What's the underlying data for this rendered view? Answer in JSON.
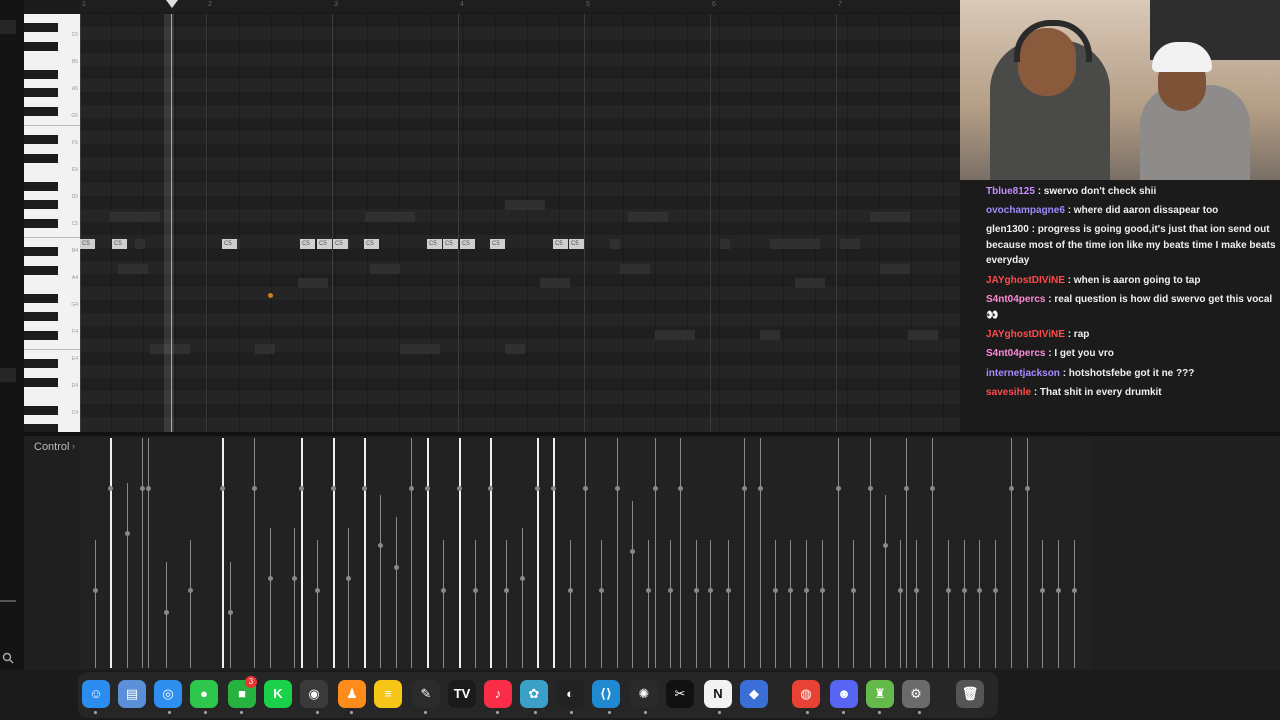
{
  "timeline": {
    "bars": [
      "1",
      "2",
      "3",
      "4",
      "5",
      "6",
      "7"
    ]
  },
  "piano": {
    "labels": [
      "C6",
      "B5",
      "A5",
      "G5",
      "F5",
      "E5",
      "D5",
      "C5",
      "B4",
      "A4",
      "G4",
      "F4",
      "E4",
      "D4",
      "C4"
    ]
  },
  "notes": {
    "label": "C5"
  },
  "control": {
    "label": "Control",
    "chevron": "›"
  },
  "chat": {
    "messages": [
      {
        "user": "Tblue8125",
        "color": "#c58cff",
        "text": " : swervo don't check shii"
      },
      {
        "user": "ovochampagne6",
        "color": "#9c8cff",
        "text": " : where did aaron dissapear too"
      },
      {
        "user": "glen1300",
        "color": "#f0f0f0",
        "text": " : progress is going good,it's just that ion send out because most of the time ion like my beats time I make beats everyday"
      },
      {
        "user": "JAYghostDIViNE",
        "color": "#ff4b4b",
        "text": " : when is aaron going to tap"
      },
      {
        "user": "S4nt04percs",
        "color": "#ff8ad8",
        "text": " : real question is how did swervo get this vocal 👀"
      },
      {
        "user": "JAYghostDIViNE",
        "color": "#ff4b4b",
        "text": " : rap"
      },
      {
        "user": "S4nt04percs",
        "color": "#ff8ad8",
        "text": " : I get you vro"
      },
      {
        "user": "internetjackson",
        "color": "#a78bff",
        "text": " : hotshotsfebe got it ne ???"
      },
      {
        "user": "savesihle",
        "color": "#ff4b4b",
        "text": " : That shit in every drumkit"
      }
    ]
  },
  "dock": {
    "badge": "3",
    "apps": [
      {
        "name": "finder-icon",
        "glyph": "☺",
        "bg": "#2d8cf0"
      },
      {
        "name": "files-icon",
        "glyph": "▤",
        "bg": "#5b8fd8"
      },
      {
        "name": "safari-icon",
        "glyph": "◎",
        "bg": "#2f8ff0"
      },
      {
        "name": "messages-icon",
        "glyph": "●",
        "bg": "#2ec64b"
      },
      {
        "name": "facetime-icon",
        "glyph": "■",
        "bg": "#27b33f"
      },
      {
        "name": "kick-icon",
        "glyph": "K",
        "bg": "#1ad14a"
      },
      {
        "name": "obs-icon",
        "glyph": "◉",
        "bg": "#3a3a3a"
      },
      {
        "name": "fl-studio-icon",
        "glyph": "♟",
        "bg": "#ff8c1a"
      },
      {
        "name": "notes-icon",
        "glyph": "≡",
        "bg": "#f5c518"
      },
      {
        "name": "app-icon",
        "glyph": "✎",
        "bg": "#2b2b2b"
      },
      {
        "name": "tradingview-icon",
        "glyph": "TV",
        "bg": "#1a1a1a"
      },
      {
        "name": "music-icon",
        "glyph": "♪",
        "bg": "#fa2d48"
      },
      {
        "name": "davinci-resolve-icon",
        "glyph": "✿",
        "bg": "#3aa0c8"
      },
      {
        "name": "github-icon",
        "glyph": "◐",
        "bg": "#222"
      },
      {
        "name": "vscode-icon",
        "glyph": "⟨⟩",
        "bg": "#1f8ad2"
      },
      {
        "name": "chatgpt-icon",
        "glyph": "✺",
        "bg": "#2a2a2a"
      },
      {
        "name": "capcut-icon",
        "glyph": "✂",
        "bg": "#111"
      },
      {
        "name": "notion-icon",
        "glyph": "N",
        "bg": "#f2f2f2"
      },
      {
        "name": "roblox-icon",
        "glyph": "◆",
        "bg": "#3a6fd8"
      },
      {
        "name": "chrome-icon",
        "glyph": "◍",
        "bg": "#e94235"
      },
      {
        "name": "discord-icon",
        "glyph": "☻",
        "bg": "#5865f2"
      },
      {
        "name": "game-icon",
        "glyph": "♜",
        "bg": "#63b94a"
      },
      {
        "name": "settings-icon",
        "glyph": "⚙",
        "bg": "#6b6b6b"
      },
      {
        "name": "trash-icon",
        "glyph": "🗑",
        "bg": "#555"
      }
    ]
  }
}
